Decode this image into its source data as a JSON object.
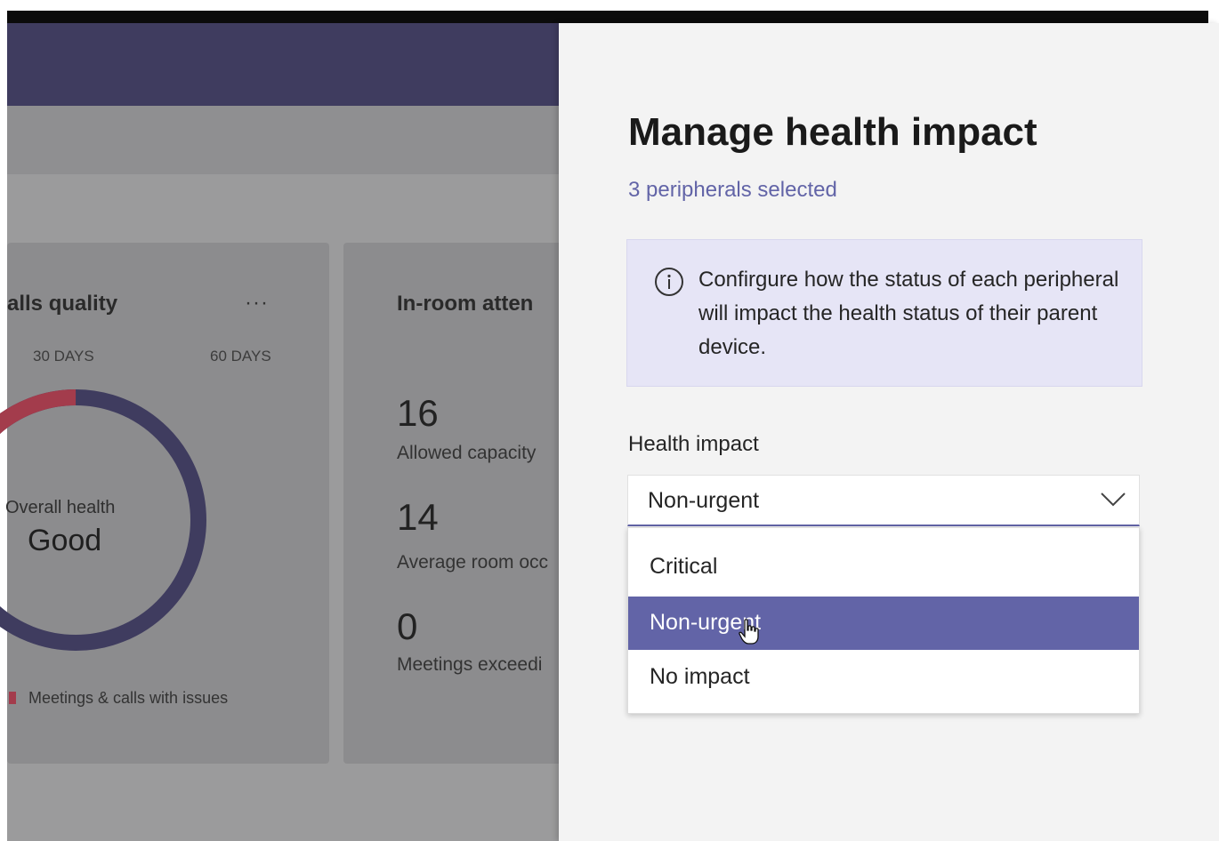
{
  "background_app": {
    "calls_card": {
      "title": "alls quality",
      "more_label": "···",
      "tabs": [
        "30 DAYS",
        "60 DAYS"
      ],
      "donut": {
        "label": "Overall health",
        "value": "Good",
        "issue_fraction": 0.25
      },
      "legend": "Meetings & calls with issues"
    },
    "attendance_card": {
      "title": "In-room atten",
      "stats": [
        {
          "value": "16",
          "label": "Allowed capacity"
        },
        {
          "value": "14",
          "label": "Average room occ"
        },
        {
          "value": "0",
          "label": "Meetings exceedi"
        }
      ]
    }
  },
  "panel": {
    "title": "Manage health impact",
    "subtitle": "3 peripherals selected",
    "info_text": "Confirgure how the status of each peripheral will impact the health status of their parent device.",
    "field_label": "Health impact",
    "selected_value": "Non-urgent",
    "options": [
      "Critical",
      "Non-urgent",
      "No impact"
    ],
    "highlighted_option": "Non-urgent"
  },
  "colors": {
    "accent": "#6264a7",
    "header": "#3f3c5f",
    "donut_main": "#3f3c5f",
    "donut_issue": "#a33c4c",
    "info_bg": "#e6e5f6"
  }
}
